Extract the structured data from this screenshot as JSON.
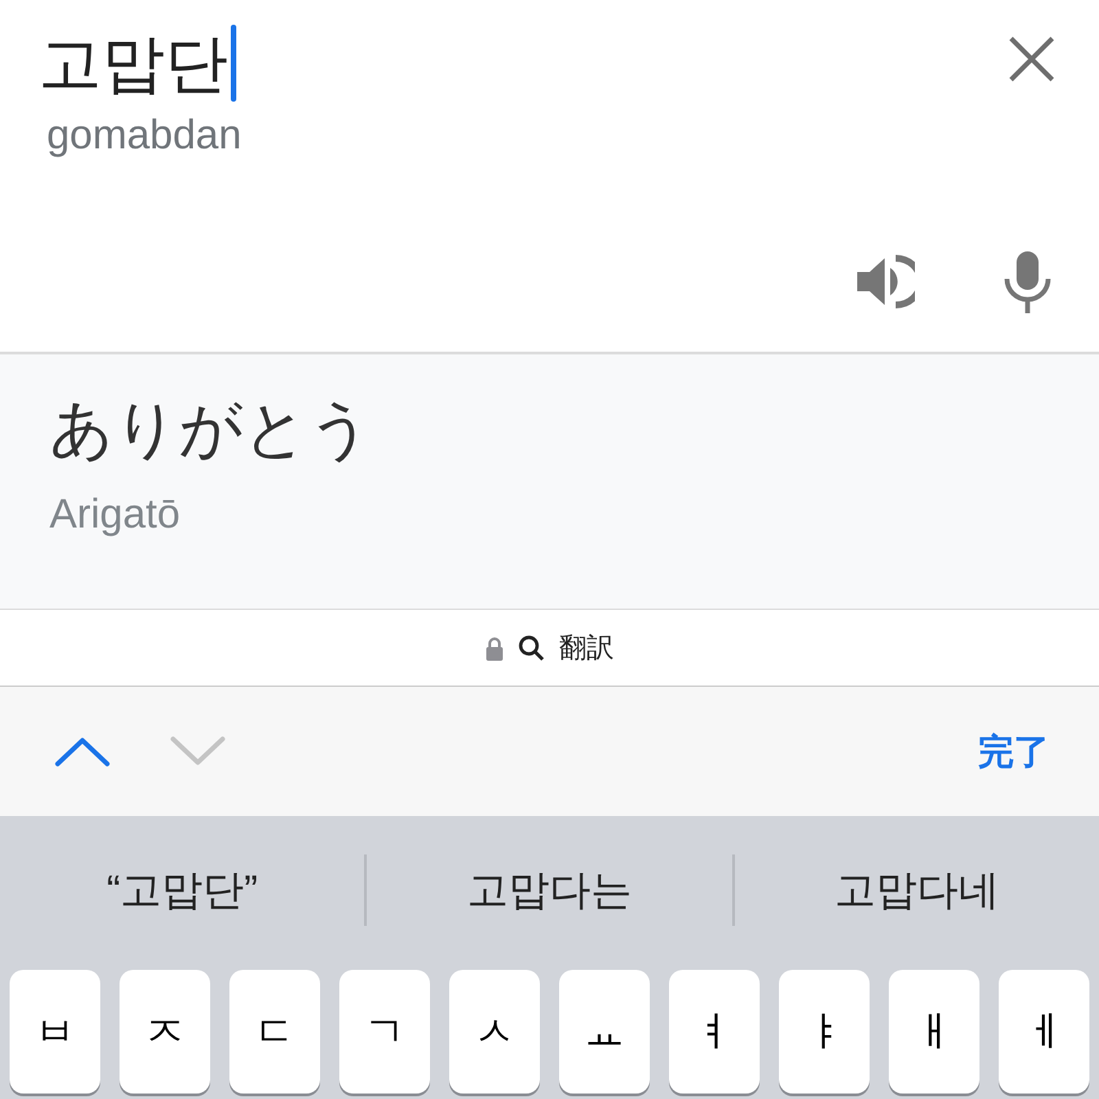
{
  "source": {
    "text": "고맙단",
    "romanization": "gomabdan"
  },
  "translation": {
    "text": "ありがとう",
    "romanization": "Arigatō"
  },
  "address_bar": {
    "text": "翻訳",
    "secure": true
  },
  "toolbar": {
    "previous": {
      "disabled": false
    },
    "next": {
      "disabled": true
    },
    "done": "完了"
  },
  "suggestions": [
    "“고맙단”",
    "고맙다는",
    "고맙다네"
  ],
  "keys": [
    "ㅂ",
    "ㅈ",
    "ㄷ",
    "ㄱ",
    "ㅅ",
    "ㅛ",
    "ㅕ",
    "ㅑ",
    "ㅐ",
    "ㅔ"
  ]
}
